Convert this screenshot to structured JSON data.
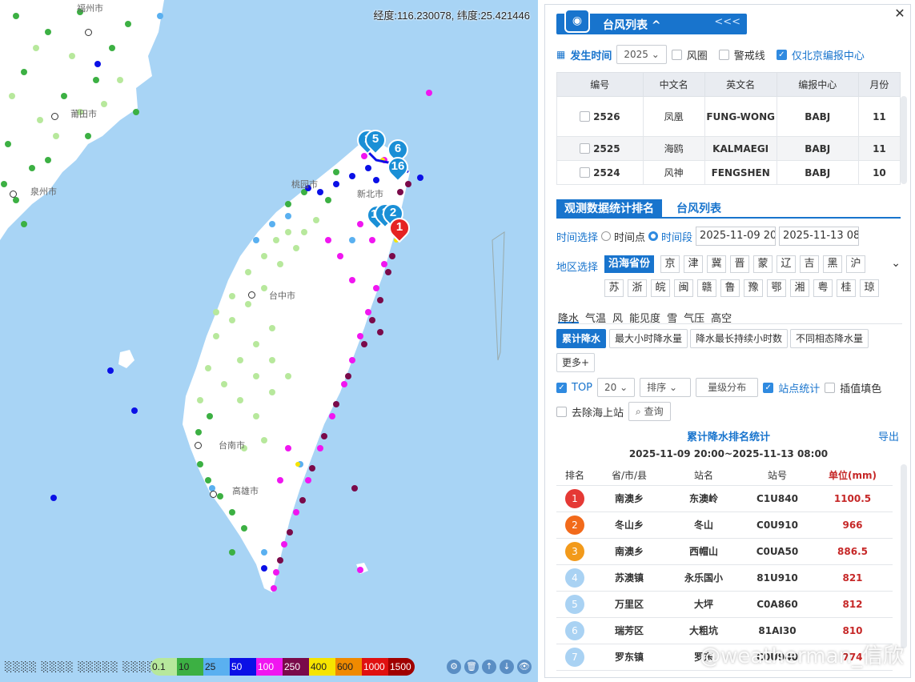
{
  "map": {
    "coord_readout": "经度:116.230078, 纬度:25.421446",
    "cities": [
      {
        "name": "福州市"
      },
      {
        "name": "莆田市"
      },
      {
        "name": "泉州市"
      },
      {
        "name": "桃园市"
      },
      {
        "name": "新北市"
      },
      {
        "name": "台中市"
      },
      {
        "name": "台南市"
      },
      {
        "name": "高雄市"
      }
    ],
    "typhoon_pins": [
      "1",
      "5",
      "6",
      "16",
      "11",
      "3",
      "2"
    ],
    "rank_pin": "1",
    "legend": {
      "blurred_label": "░░░░ ░░░░ ░░░░░ ░░░░",
      "levels": [
        {
          "label": "0.1",
          "color": "#b7e89c"
        },
        {
          "label": "10",
          "color": "#3cb043"
        },
        {
          "label": "25",
          "color": "#5ab0f0"
        },
        {
          "label": "50",
          "color": "#0b10e6"
        },
        {
          "label": "100",
          "color": "#f016f0"
        },
        {
          "label": "250",
          "color": "#7a0a4a"
        },
        {
          "label": "400",
          "color": "#f6e400"
        },
        {
          "label": "600",
          "color": "#f08a00"
        },
        {
          "label": "1000",
          "color": "#e01010"
        },
        {
          "label": "1500",
          "color": "#a00000"
        }
      ],
      "tools": [
        "⚙",
        "🗑",
        "↑",
        "↓",
        "👁"
      ]
    }
  },
  "panel": {
    "close": "✕",
    "header_title": "台风列表",
    "header_caret": "^",
    "collapse": "<<<",
    "time_label": "发生时间",
    "year": "2025",
    "circle_label": "风圈",
    "warning_label": "警戒线",
    "beijing_only_label": "仅北京编报中心",
    "typhoon_table": {
      "headers": [
        "编号",
        "中文名",
        "英文名",
        "编报中心",
        "月份"
      ],
      "rows": [
        {
          "id": "2526",
          "cn": "凤凰",
          "en": "FUNG-WONG",
          "center": "BABJ",
          "month": "11"
        },
        {
          "id": "2525",
          "cn": "海鸥",
          "en": "KALMAEGI",
          "center": "BABJ",
          "month": "11"
        },
        {
          "id": "2524",
          "cn": "风神",
          "en": "FENGSHEN",
          "center": "BABJ",
          "month": "10"
        }
      ]
    },
    "tabs": {
      "active": "观测数据统计排名",
      "other": "台风列表"
    },
    "time_select": {
      "label": "时间选择",
      "point": "时间点",
      "range": "时间段",
      "start": "2025-11-09 20:",
      "end": "2025-11-13 08:"
    },
    "region": {
      "label": "地区选择",
      "coastal": "沿海省份",
      "row1": [
        "京",
        "津",
        "冀",
        "晋",
        "蒙",
        "辽",
        "吉",
        "黑",
        "沪"
      ],
      "row2": [
        "苏",
        "浙",
        "皖",
        "闽",
        "赣",
        "鲁",
        "豫",
        "鄂",
        "湘",
        "粤",
        "桂",
        "琼"
      ]
    },
    "elements": [
      "降水",
      "气温",
      "风",
      "能见度",
      "雪",
      "气压",
      "高空"
    ],
    "precip_buttons": [
      "累计降水",
      "最大小时降水量",
      "降水最长持续小时数",
      "不同相态降水量",
      "更多+"
    ],
    "options": {
      "top_label": "TOP",
      "top_value": "20",
      "sort": "排序",
      "grade": "量级分布",
      "station_stats": "站点统计",
      "interp_fill": "插值填色",
      "remove_sea": "去除海上站",
      "query": "查询"
    },
    "stats": {
      "title": "累计降水排名统计",
      "export": "导出",
      "range": "2025-11-09 20:00~2025-11-13 08:00",
      "headers": [
        "排名",
        "省/市/县",
        "站名",
        "站号",
        "单位(mm)"
      ],
      "rows": [
        {
          "rank": "1",
          "county": "南澳乡",
          "station": "东澳岭",
          "code": "C1U840",
          "value": "1100.5",
          "color": "#e53935"
        },
        {
          "rank": "2",
          "county": "冬山乡",
          "station": "冬山",
          "code": "C0U910",
          "value": "966",
          "color": "#f26a1b"
        },
        {
          "rank": "3",
          "county": "南澳乡",
          "station": "西帽山",
          "code": "C0UA50",
          "value": "886.5",
          "color": "#f29a1b"
        },
        {
          "rank": "4",
          "county": "苏澳镇",
          "station": "永乐国小",
          "code": "81U910",
          "value": "821",
          "color": "#a9d2f3"
        },
        {
          "rank": "5",
          "county": "万里区",
          "station": "大坪",
          "code": "C0A860",
          "value": "812",
          "color": "#a9d2f3"
        },
        {
          "rank": "6",
          "county": "瑞芳区",
          "station": "大粗坑",
          "code": "81AI30",
          "value": "810",
          "color": "#a9d2f3"
        },
        {
          "rank": "7",
          "county": "罗东镇",
          "station": "罗东",
          "code": "C0U940",
          "value": "774",
          "color": "#a9d2f3"
        }
      ]
    },
    "watermark": "@weatherman_信欣"
  }
}
